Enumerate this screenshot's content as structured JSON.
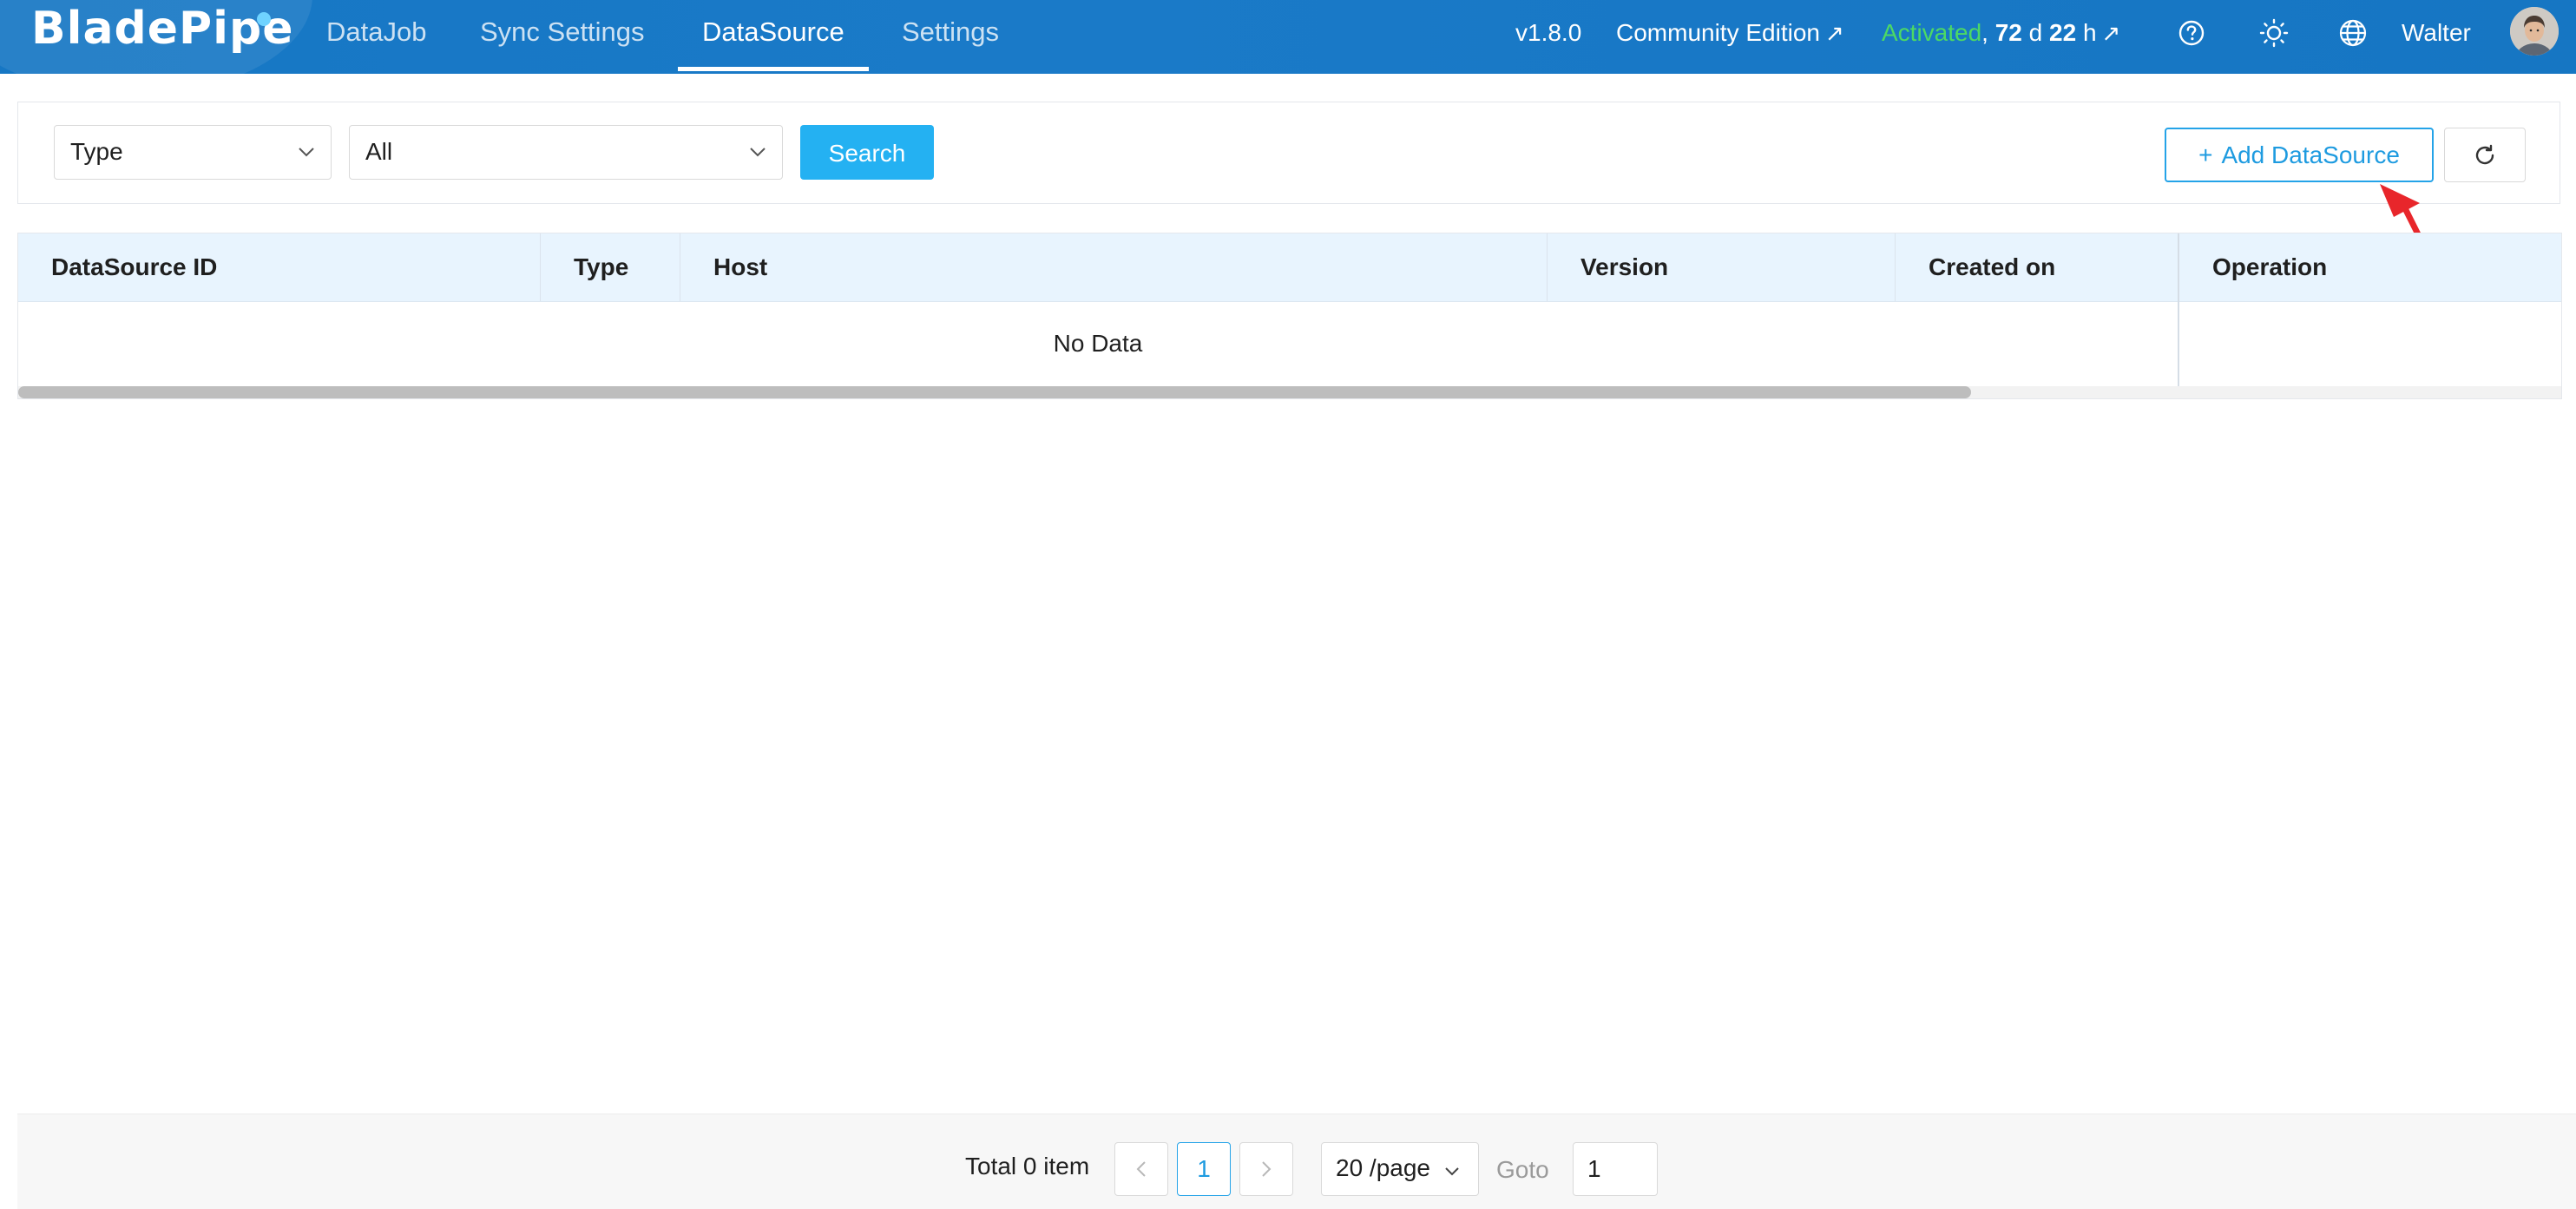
{
  "app": {
    "logo_text": "BladePipe",
    "nav": [
      {
        "label": "DataJob"
      },
      {
        "label": "Sync Settings"
      },
      {
        "label": "DataSource"
      },
      {
        "label": "Settings"
      }
    ],
    "version": "v1.8.0",
    "edition": "Community Edition",
    "license": {
      "status": "Activated",
      "days_value": "72",
      "days_unit": "d",
      "hours_value": "22",
      "hours_unit": "h"
    },
    "icons": [
      "help-icon",
      "theme-sun-icon",
      "language-globe-icon"
    ],
    "user": "Walter"
  },
  "filters": {
    "type_select": "Type",
    "value_select": "All",
    "search_label": "Search",
    "add_label": "Add DataSource"
  },
  "table": {
    "columns": [
      "DataSource ID",
      "Type",
      "Host",
      "Version",
      "Created on",
      "Operation"
    ],
    "empty_text": "No Data"
  },
  "pagination": {
    "total_text": "Total 0 item",
    "current_page": "1",
    "page_size": "20 /page",
    "goto_label": "Goto",
    "goto_value": "1"
  },
  "colors": {
    "header_bg": "#1677c4",
    "accent": "#24b1f2",
    "activated": "#4cd964",
    "annotation": "#e8262b"
  }
}
